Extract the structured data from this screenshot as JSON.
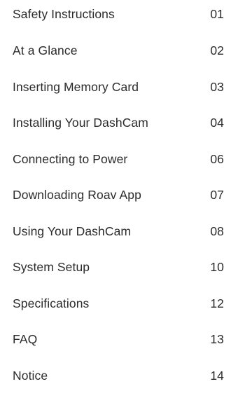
{
  "toc": {
    "entries": [
      {
        "title": "Safety Instructions",
        "page": "01"
      },
      {
        "title": "At a Glance",
        "page": "02"
      },
      {
        "title": "Inserting Memory Card",
        "page": "03"
      },
      {
        "title": "Installing Your DashCam",
        "page": "04"
      },
      {
        "title": "Connecting to Power",
        "page": "06"
      },
      {
        "title": "Downloading Roav App",
        "page": "07"
      },
      {
        "title": "Using Your DashCam",
        "page": "08"
      },
      {
        "title": "System Setup",
        "page": "10"
      },
      {
        "title": "Specifications",
        "page": "12"
      },
      {
        "title": "FAQ",
        "page": "13"
      },
      {
        "title": "Notice",
        "page": "14"
      }
    ]
  }
}
